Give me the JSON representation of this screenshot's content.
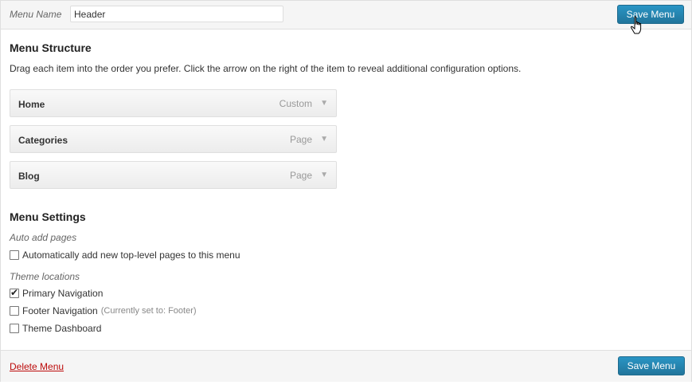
{
  "header": {
    "menu_name_label": "Menu Name",
    "menu_name_value": "Header",
    "save_label": "Save Menu"
  },
  "structure": {
    "title": "Menu Structure",
    "instructions": "Drag each item into the order you prefer. Click the arrow on the right of the item to reveal additional configuration options.",
    "items": [
      {
        "title": "Home",
        "type": "Custom"
      },
      {
        "title": "Categories",
        "type": "Page"
      },
      {
        "title": "Blog",
        "type": "Page"
      }
    ]
  },
  "settings": {
    "title": "Menu Settings",
    "auto_add_label": "Auto add pages",
    "auto_add_option": "Automatically add new top-level pages to this menu",
    "auto_add_checked": false,
    "theme_locations_label": "Theme locations",
    "locations": [
      {
        "label": "Primary Navigation",
        "note": "",
        "checked": true
      },
      {
        "label": "Footer Navigation",
        "note": "(Currently set to: Footer)",
        "checked": false
      },
      {
        "label": "Theme Dashboard",
        "note": "",
        "checked": false
      }
    ]
  },
  "footer": {
    "delete_label": "Delete Menu",
    "save_label": "Save Menu"
  },
  "colors": {
    "primary_button": "#21759b",
    "delete_link": "#bc0b0b"
  },
  "icons": {
    "dropdown_arrow": "▼",
    "checkmark": "✔",
    "cursor": "hand-pointer-icon"
  }
}
